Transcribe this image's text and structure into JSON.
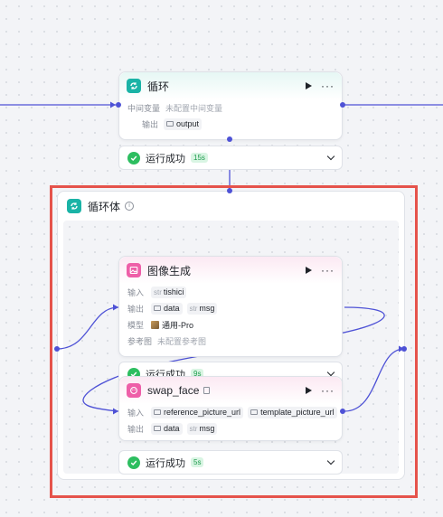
{
  "loop_node": {
    "title": "循环",
    "rows": {
      "intermediate_label": "中间变量",
      "intermediate_value": "未配置中间变量",
      "output_label": "输出",
      "output_value": "output"
    }
  },
  "loop_status": {
    "label": "运行成功",
    "duration": "15s"
  },
  "loop_body": {
    "title": "循环体"
  },
  "image_gen_node": {
    "title": "图像生成",
    "input_label": "输入",
    "input_type": "str",
    "input_value": "tishici",
    "output_label": "输出",
    "output_values": [
      "data",
      "msg"
    ],
    "output_types": [
      "img",
      "str"
    ],
    "model_label": "模型",
    "model_value": "通用-Pro",
    "ref_label": "参考图",
    "ref_value": "未配置参考图"
  },
  "image_gen_status": {
    "label": "运行成功",
    "duration": "9s"
  },
  "swap_face_node": {
    "title": "swap_face",
    "input_label": "输入",
    "inputs": [
      "reference_picture_url",
      "template_picture_url"
    ],
    "output_label": "输出",
    "output_values": [
      "data",
      "msg"
    ]
  },
  "swap_face_status": {
    "label": "运行成功",
    "duration": "5s"
  },
  "colors": {
    "edge": "#4e52d6",
    "highlight": "#e5534b",
    "success": "#2dbe60",
    "teal": "#1ab3a6",
    "pink": "#ee5fa8"
  }
}
